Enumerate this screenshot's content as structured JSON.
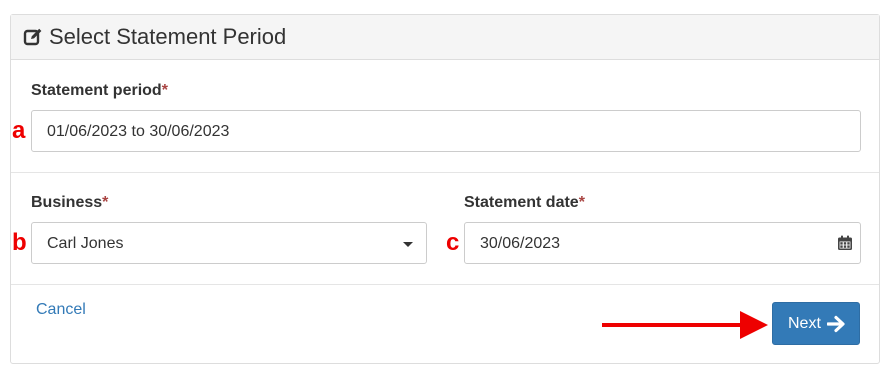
{
  "panel": {
    "title": "Select Statement Period",
    "title_icon": "edit-icon"
  },
  "statement_period": {
    "label": "Statement period",
    "required_mark": "*",
    "value": "01/06/2023 to 30/06/2023",
    "marker": "a"
  },
  "business": {
    "label": "Business",
    "required_mark": "*",
    "value": "Carl Jones",
    "marker": "b",
    "icon": "caret-down-icon"
  },
  "statement_date": {
    "label": "Statement date",
    "required_mark": "*",
    "value": "30/06/2023",
    "marker": "c",
    "icon": "calendar-icon"
  },
  "footer": {
    "cancel_label": "Cancel",
    "next_label": "Next",
    "next_icon": "arrow-right-icon"
  },
  "colors": {
    "primary": "#337ab7",
    "required": "#a94442",
    "annotation": "#ee0000",
    "heading_bg": "#f5f5f5"
  }
}
